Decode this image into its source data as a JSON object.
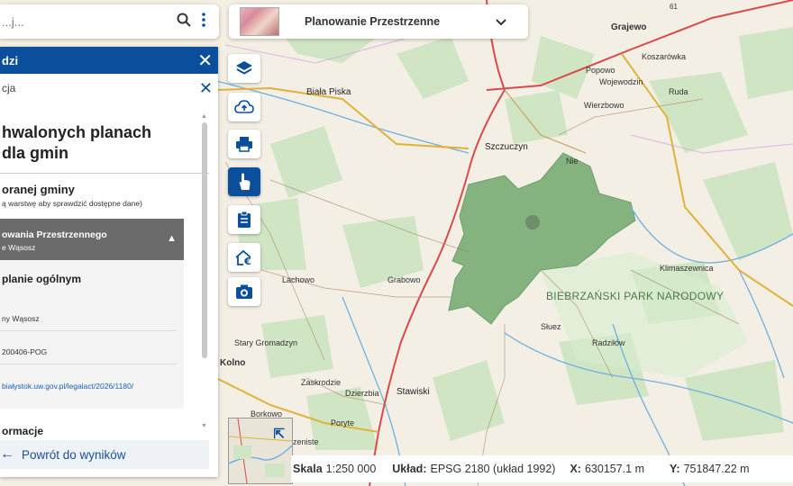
{
  "search": {
    "placeholder": "...j..."
  },
  "panel": {
    "header": "dzi",
    "subheader": "cja",
    "title_line1": "hwalonych planach",
    "title_line2": "dla gmin",
    "selected_title": "oranej gminy",
    "selected_hint": "ą warstwę aby sprawdzić dostępne dane)",
    "accordion_title": "owania Przestrzennego",
    "accordion_subtitle": "e Wąsosz",
    "plan_heading": "planie ogólnym",
    "row1": "ny Wąsosz",
    "row2": "200406-POG",
    "row3": "białystok.uw.gov.pl/legalact/2026/1180/",
    "info_heading": "ormacje",
    "back_label": "Powrót do wyników"
  },
  "layer": {
    "label": "Planowanie Przestrzenne"
  },
  "status": {
    "scale_label": "Skala",
    "scale_value": "1:250 000",
    "crs_label": "Układ:",
    "crs_value": "EPSG 2180 (układ 1992)",
    "x_label": "X:",
    "x_value": "630157.1 m",
    "y_label": "Y:",
    "y_value": "751847.22 m"
  },
  "map_labels": {
    "grajewo": "Grajewo",
    "koszarowka": "Koszarówka",
    "popowo": "Popowo",
    "wojewodzin": "Wojewodzin",
    "ruda": "Ruda",
    "wierzbowo": "Wierzbowo",
    "biala_piska": "Biała Piska",
    "szczuczyn": "Szczuczyn",
    "niedzwiadna": "Nie",
    "klimaszewnica": "Klimaszewnica",
    "park": "BIEBRZAŃSKI PARK NARODOWY",
    "lachowo": "Lachowo",
    "grabowo": "Grabowo",
    "stary_gromadzyn": "Stary Gromadzyn",
    "kolno": "Kolno",
    "sluez": "Słuez",
    "radzilow": "Radziłów",
    "zaskrodzie": "Zaskrodzie",
    "dzierzbia": "Dzierzbia",
    "stawiski": "Stawiski",
    "borkowo": "Borkowo",
    "poryte": "Poryte",
    "zeniste": "zeniste",
    "road_61": "61"
  },
  "colors": {
    "brand": "#0b4f9c",
    "polygon": "#7fb07a"
  }
}
